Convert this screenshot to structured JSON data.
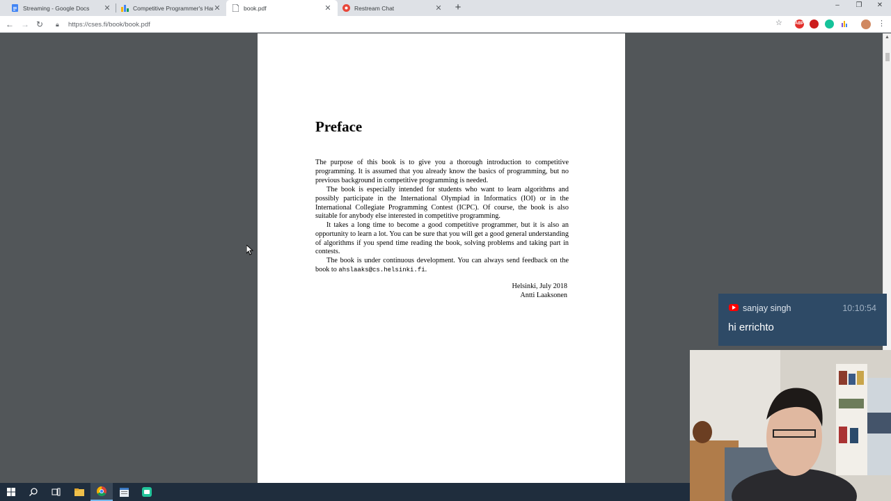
{
  "browser": {
    "tabs": [
      {
        "title": "Streaming - Google Docs",
        "icon": "google-docs-icon",
        "active": false
      },
      {
        "title": "Competitive Programmer's Handbook",
        "icon": "chart-bars-icon",
        "active": false
      },
      {
        "title": "book.pdf",
        "icon": "document-icon",
        "active": true
      },
      {
        "title": "Restream Chat",
        "icon": "restream-icon",
        "active": false
      }
    ],
    "new_tab_label": "+",
    "url": "https://cses.fi/book/book.pdf"
  },
  "extensions": [
    {
      "name": "adblock-icon",
      "label": "ABP",
      "color": "#e3302c"
    },
    {
      "name": "opera-icon",
      "label": "",
      "color": "#cc1d1d"
    },
    {
      "name": "grammarly-icon",
      "label": "",
      "color": "#15c39a"
    },
    {
      "name": "ext-bars-icon",
      "label": "",
      "color": "#7b4fd6"
    }
  ],
  "pdf": {
    "heading": "Preface",
    "paragraphs": [
      "The purpose of this book is to give you a thorough introduction to competitive programming. It is assumed that you already know the basics of programming, but no previous background in competitive programming is needed.",
      "The book is especially intended for students who want to learn algorithms and possibly participate in the International Olympiad in Informatics (IOI) or in the International Collegiate Programming Contest (ICPC). Of course, the book is also suitable for anybody else interested in competitive programming.",
      "It takes a long time to become a good competitive programmer, but it is also an opportunity to learn a lot. You can be sure that you will get a good general understanding of algorithms if you spend time reading the book, solving problems and taking part in contests."
    ],
    "last_paragraph_text": "The book is under continuous development. You can always send feedback on the book to",
    "email": "ahslaaks@cs.helsinki.fi",
    "email_suffix": ".",
    "signature_place": "Helsinki, July 2018",
    "signature_name": "Antti Laaksonen"
  },
  "chat": {
    "user": "sanjay singh",
    "time": "10:10:54",
    "message": "hi errichto",
    "platform_icon": "youtube-icon"
  },
  "colors": {
    "viewer_bg": "#525659",
    "chat_bg": "#2e4a66",
    "taskbar_bg": "#1f2d3d"
  }
}
